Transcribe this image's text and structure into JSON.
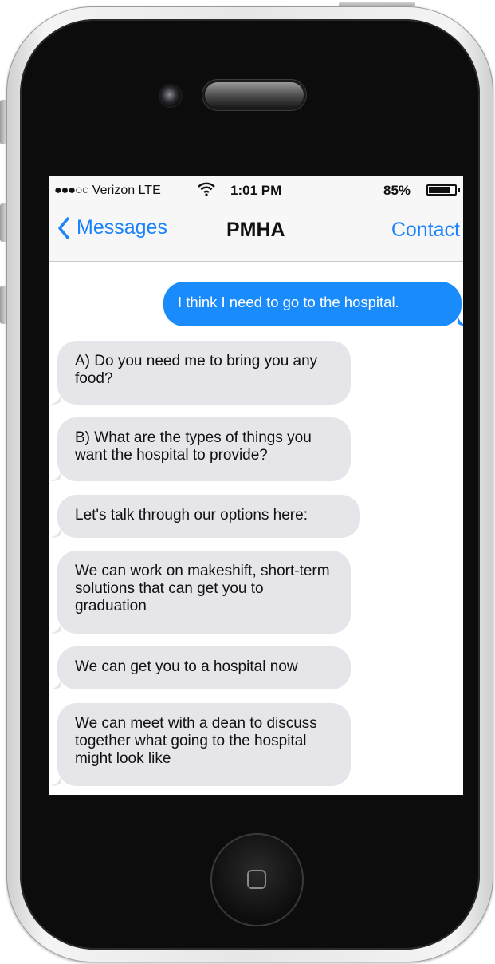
{
  "status_bar": {
    "signal": "●●●○○",
    "carrier": "Verizon LTE",
    "time": "1:01 PM",
    "battery_percent": "85%",
    "battery_level": 0.85
  },
  "nav": {
    "back_label": "Messages",
    "title": "PMHA",
    "contact_label": "Contact"
  },
  "messages": [
    {
      "direction": "outgoing",
      "text": "I think I need to go to the hospital."
    },
    {
      "direction": "incoming",
      "text": "A) Do you need me to bring you any food?"
    },
    {
      "direction": "incoming",
      "text": "B) What are the types of things you want the hospital to provide?"
    },
    {
      "direction": "incoming",
      "text": "Let's talk through our options here:"
    },
    {
      "direction": "incoming",
      "text": "We can work on makeshift, short-term solutions that can get you to graduation"
    },
    {
      "direction": "incoming",
      "text": "We can get you to a hospital now"
    },
    {
      "direction": "incoming",
      "text": "We can meet with a dean to discuss together what going to the hospital might look like"
    }
  ],
  "colors": {
    "accent": "#1a82fb",
    "outgoing_bubble": "#1a8bfb",
    "incoming_bubble": "#e5e5ea",
    "device_bezel": "#0c0c0c"
  }
}
